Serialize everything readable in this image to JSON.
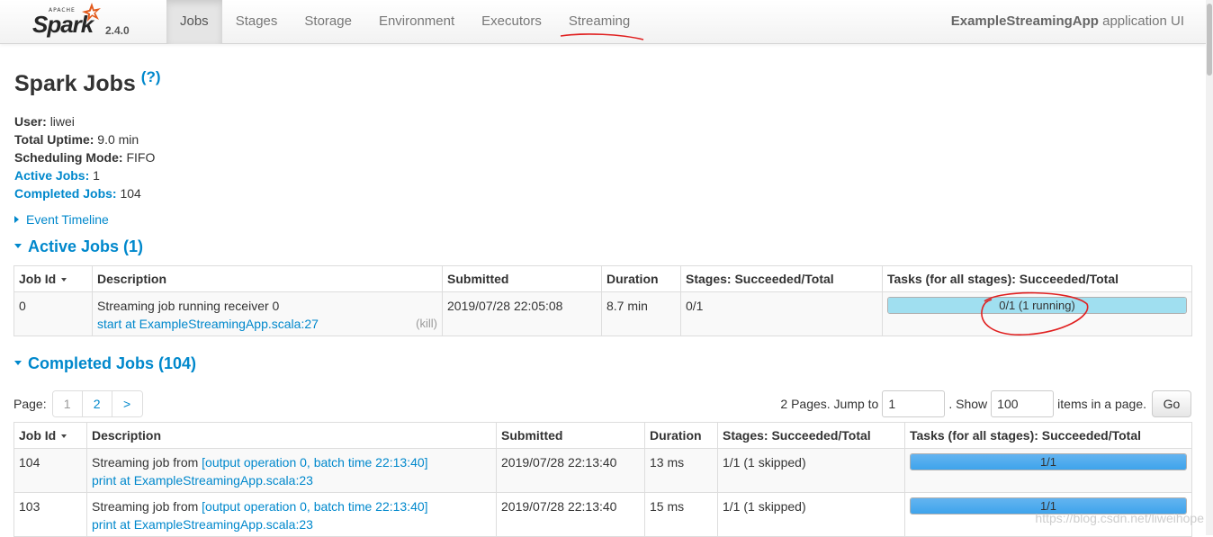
{
  "navbar": {
    "brand": {
      "apache": "APACHE",
      "name": "Spark",
      "version": "2.4.0"
    },
    "tabs": [
      {
        "label": "Jobs",
        "active": true
      },
      {
        "label": "Stages"
      },
      {
        "label": "Storage"
      },
      {
        "label": "Environment"
      },
      {
        "label": "Executors"
      },
      {
        "label": "Streaming"
      }
    ],
    "app_name": "ExampleStreamingApp",
    "app_suffix": "application UI"
  },
  "page": {
    "title": "Spark Jobs",
    "help": "(?)"
  },
  "summary": {
    "user_label": "User:",
    "user": "liwei",
    "uptime_label": "Total Uptime:",
    "uptime": "9.0 min",
    "scheduling_label": "Scheduling Mode:",
    "scheduling": "FIFO",
    "active_label": "Active Jobs:",
    "active": "1",
    "completed_label": "Completed Jobs:",
    "completed": "104"
  },
  "event_timeline": "Event Timeline",
  "active_jobs": {
    "heading": "Active Jobs (1)",
    "columns": [
      "Job Id",
      "Description",
      "Submitted",
      "Duration",
      "Stages: Succeeded/Total",
      "Tasks (for all stages): Succeeded/Total"
    ],
    "rows": [
      {
        "id": "0",
        "desc": "Streaming job running receiver 0",
        "link": "start at ExampleStreamingApp.scala:27",
        "kill": "(kill)",
        "submitted": "2019/07/28 22:05:08",
        "duration": "8.7 min",
        "stages": "0/1",
        "tasks_label": "0/1 (1 running)",
        "tasks_completed_fraction": 0,
        "tasks_running_fraction": 1
      }
    ]
  },
  "completed_jobs": {
    "heading": "Completed Jobs (104)",
    "page_label": "Page:",
    "pages": [
      "1",
      "2",
      ">"
    ],
    "pages_info": "2 Pages. Jump to",
    "jump_value": "1",
    "show_label": ". Show",
    "show_value": "100",
    "items_label": "items in a page.",
    "go_label": "Go",
    "columns": [
      "Job Id",
      "Description",
      "Submitted",
      "Duration",
      "Stages: Succeeded/Total",
      "Tasks (for all stages): Succeeded/Total"
    ],
    "rows": [
      {
        "id": "104",
        "desc_prefix": "Streaming job from ",
        "desc_link": "[output operation 0, batch time 22:13:40]",
        "link": "print at ExampleStreamingApp.scala:23",
        "submitted": "2019/07/28 22:13:40",
        "duration": "13 ms",
        "stages": "1/1 (1 skipped)",
        "tasks_label": "1/1",
        "tasks_completed_fraction": 1
      },
      {
        "id": "103",
        "desc_prefix": "Streaming job from ",
        "desc_link": "[output operation 0, batch time 22:13:40]",
        "link": "print at ExampleStreamingApp.scala:23",
        "submitted": "2019/07/28 22:13:40",
        "duration": "15 ms",
        "stages": "1/1 (1 skipped)",
        "tasks_label": "1/1",
        "tasks_completed_fraction": 1
      }
    ]
  },
  "watermark": "https://blog.csdn.net/liweihope",
  "colors": {
    "link": "#0088cc",
    "completed_bar": "#3ea4ec",
    "running_bar": "#a0dff0",
    "annotation": "#e02020"
  }
}
